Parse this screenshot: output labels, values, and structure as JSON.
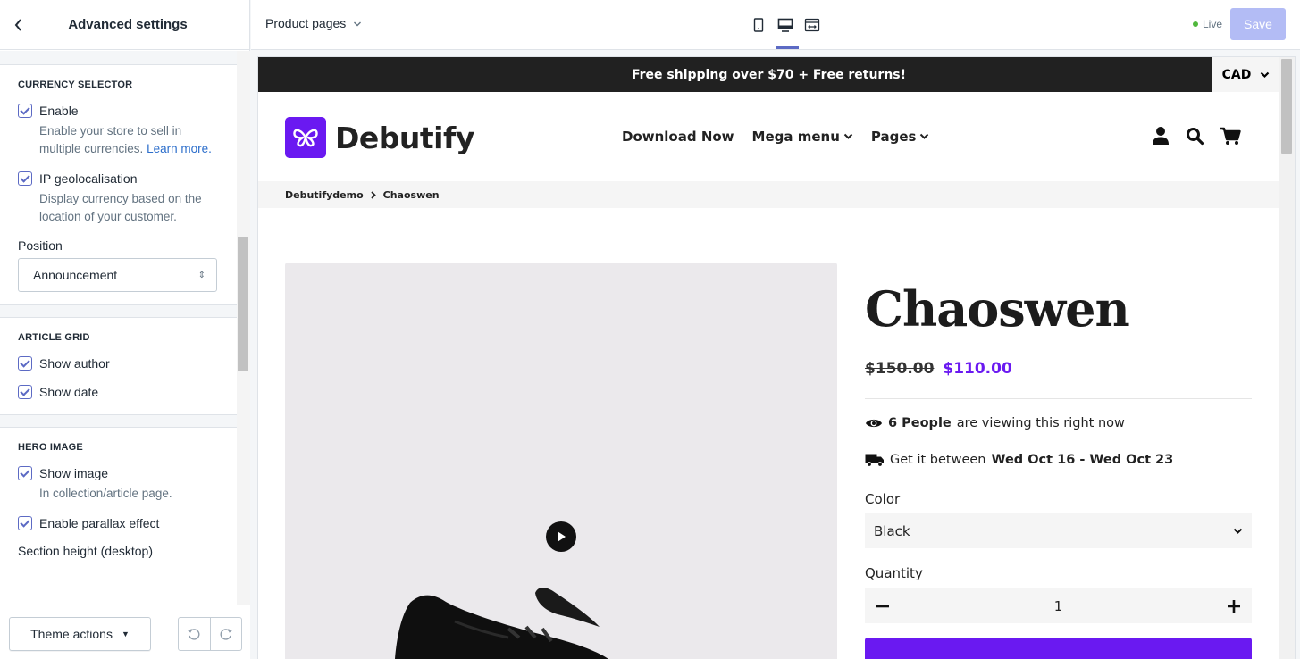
{
  "sidebar": {
    "title": "Advanced settings",
    "currency": {
      "heading": "CURRENCY SELECTOR",
      "enable_label": "Enable",
      "enable_help": "Enable your store to sell in multiple currencies.",
      "enable_help_link": "Learn more.",
      "ip_label": "IP geolocalisation",
      "ip_help": "Display currency based on the location of your customer.",
      "position_label": "Position",
      "position_value": "Announcement"
    },
    "article": {
      "heading": "ARTICLE GRID",
      "show_author": "Show author",
      "show_date": "Show date"
    },
    "hero": {
      "heading": "HERO IMAGE",
      "show_image": "Show image",
      "show_image_help": "In collection/article page.",
      "parallax": "Enable parallax effect",
      "section_height": "Section height (desktop)"
    },
    "footer": {
      "theme_actions": "Theme actions"
    }
  },
  "topbar": {
    "page_selector": "Product pages",
    "live_label": "Live",
    "save_label": "Save",
    "active_device": "desktop"
  },
  "preview": {
    "announcement": "Free shipping over $70 + Free returns!",
    "currency": "CAD",
    "logo_text": "Debutify",
    "nav": [
      "Download Now",
      "Mega menu",
      "Pages"
    ],
    "breadcrumb": [
      "Debutifydemo",
      "Chaoswen"
    ],
    "product": {
      "title": "Chaoswen",
      "price_old": "$150.00",
      "price_new": "$110.00",
      "viewers_count": "6 People",
      "viewers_text": "are viewing this right now",
      "delivery_prefix": "Get it between",
      "delivery_range": "Wed Oct 16 - Wed Oct 23",
      "color_label": "Color",
      "color_value": "Black",
      "qty_label": "Quantity",
      "qty_value": "1"
    }
  },
  "colors": {
    "accent": "#5c6ac4",
    "brand": "#6a19f1",
    "live": "#50b83c",
    "save_disabled": "#b3bcf5"
  }
}
